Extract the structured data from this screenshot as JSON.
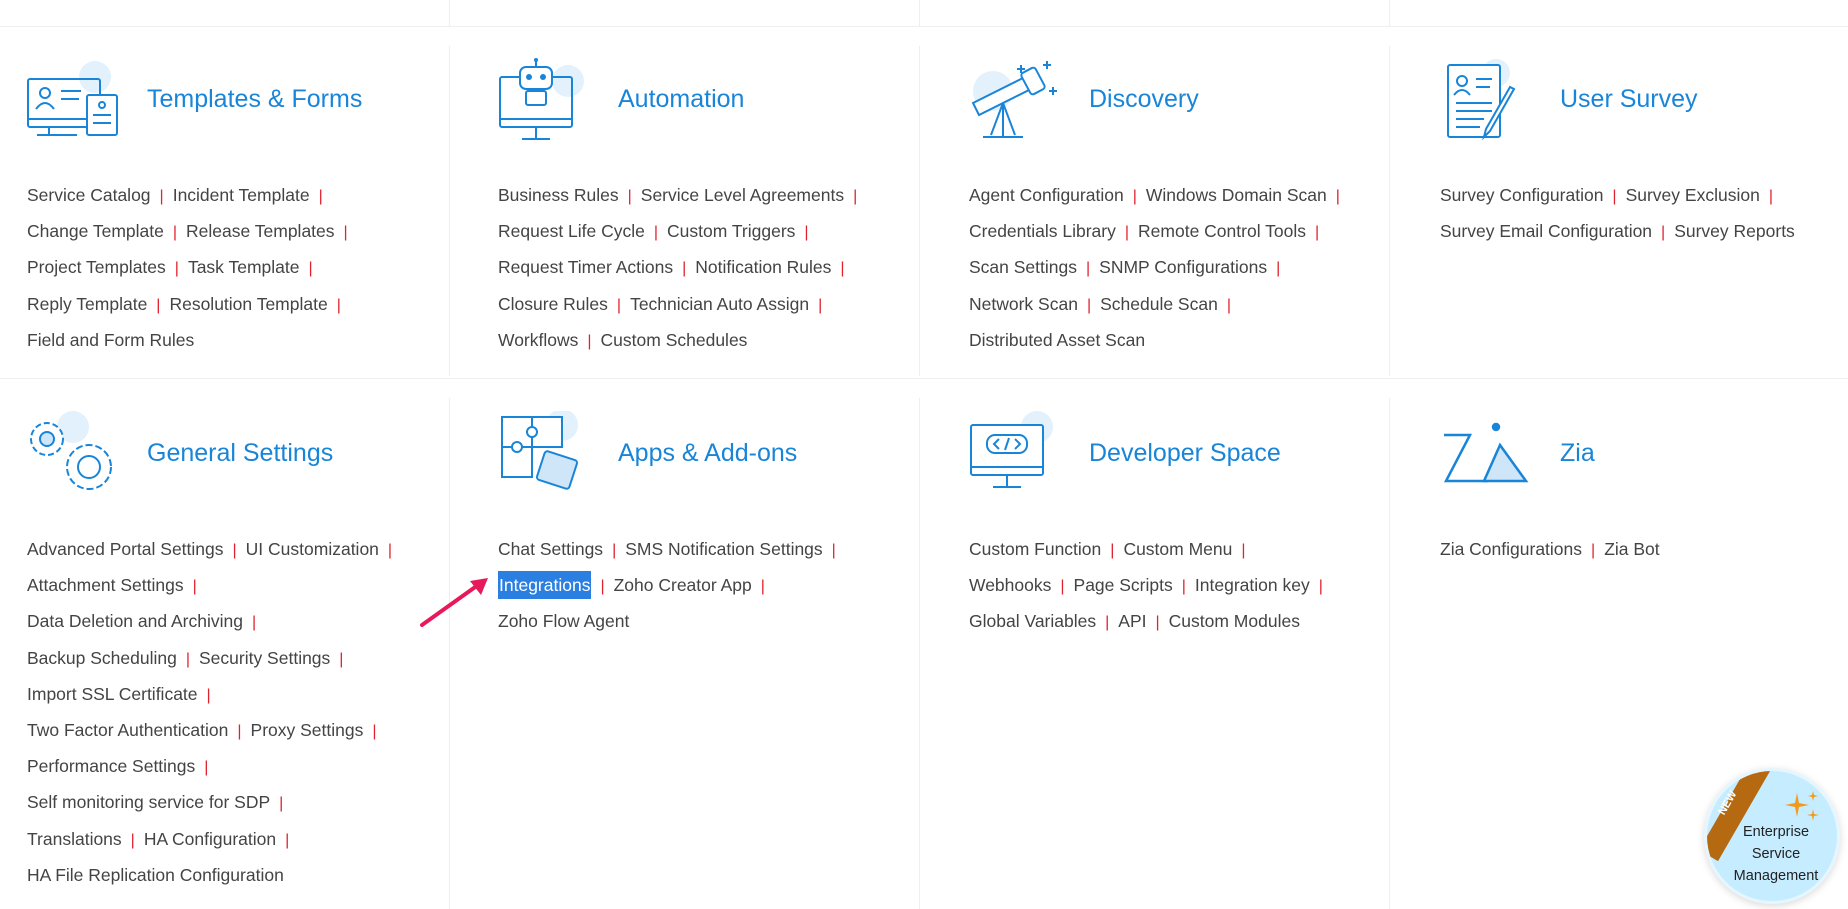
{
  "sections": [
    {
      "title": "Templates & Forms",
      "icon": "templates-forms-icon",
      "rows": [
        [
          "Service Catalog",
          "Incident Template"
        ],
        [
          "Change Template",
          "Release Templates"
        ],
        [
          "Project Templates",
          "Task Template"
        ],
        [
          "Reply Template",
          "Resolution Template"
        ],
        [
          "Field and Form Rules"
        ]
      ]
    },
    {
      "title": "Automation",
      "icon": "automation-robot-icon",
      "rows": [
        [
          "Business Rules",
          "Service Level Agreements"
        ],
        [
          "Request Life Cycle",
          "Custom Triggers"
        ],
        [
          "Request Timer Actions",
          "Notification Rules"
        ],
        [
          "Closure Rules",
          "Technician Auto Assign"
        ],
        [
          "Workflows",
          "Custom Schedules"
        ]
      ]
    },
    {
      "title": "Discovery",
      "icon": "discovery-telescope-icon",
      "rows": [
        [
          "Agent Configuration",
          "Windows Domain Scan"
        ],
        [
          "Credentials Library",
          "Remote Control Tools"
        ],
        [
          "Scan Settings",
          "SNMP Configurations"
        ],
        [
          "Network Scan",
          "Schedule Scan"
        ],
        [
          "Distributed Asset Scan"
        ]
      ]
    },
    {
      "title": "User Survey",
      "icon": "user-survey-icon",
      "rows": [
        [
          "Survey Configuration",
          "Survey Exclusion"
        ],
        [
          "Survey Email Configuration",
          "Survey Reports"
        ]
      ]
    },
    {
      "title": "General Settings",
      "icon": "general-settings-gears-icon",
      "rows": [
        [
          "Advanced Portal Settings",
          "UI Customization"
        ],
        [
          "Attachment Settings"
        ],
        [
          "Data Deletion and Archiving"
        ],
        [
          "Backup Scheduling",
          "Security Settings"
        ],
        [
          "Import SSL Certificate"
        ],
        [
          "Two Factor Authentication",
          "Proxy Settings"
        ],
        [
          "Performance Settings"
        ],
        [
          "Self monitoring service for SDP"
        ],
        [
          "Translations",
          "HA Configuration"
        ],
        [
          "HA File Replication Configuration"
        ]
      ]
    },
    {
      "title": "Apps & Add-ons",
      "icon": "apps-addons-puzzle-icon",
      "rows": [
        [
          "Chat Settings",
          "SMS Notification Settings"
        ],
        [
          "Integrations",
          "Zoho Creator App"
        ],
        [
          "Zoho Flow Agent"
        ]
      ]
    },
    {
      "title": "Developer Space",
      "icon": "developer-space-code-icon",
      "rows": [
        [
          "Custom Function",
          "Custom Menu"
        ],
        [
          "Webhooks",
          "Page Scripts",
          "Integration key"
        ],
        [
          "Global Variables",
          "API",
          "Custom Modules"
        ]
      ]
    },
    {
      "title": "Zia",
      "icon": "zia-logo-icon",
      "rows": [
        [
          "Zia Configurations",
          "Zia Bot"
        ]
      ]
    }
  ],
  "highlighted_link": "Integrations",
  "badge": {
    "ribbon": "NEW",
    "line1": "Enterprise",
    "line2": "Service",
    "line3": "Management"
  },
  "colors": {
    "title": "#1985d8",
    "separator": "#e0212e",
    "highlight": "#2a7fe0",
    "arrow": "#e8195a",
    "badge_bg": "#c6ecff",
    "ribbon": "#b56a12"
  }
}
